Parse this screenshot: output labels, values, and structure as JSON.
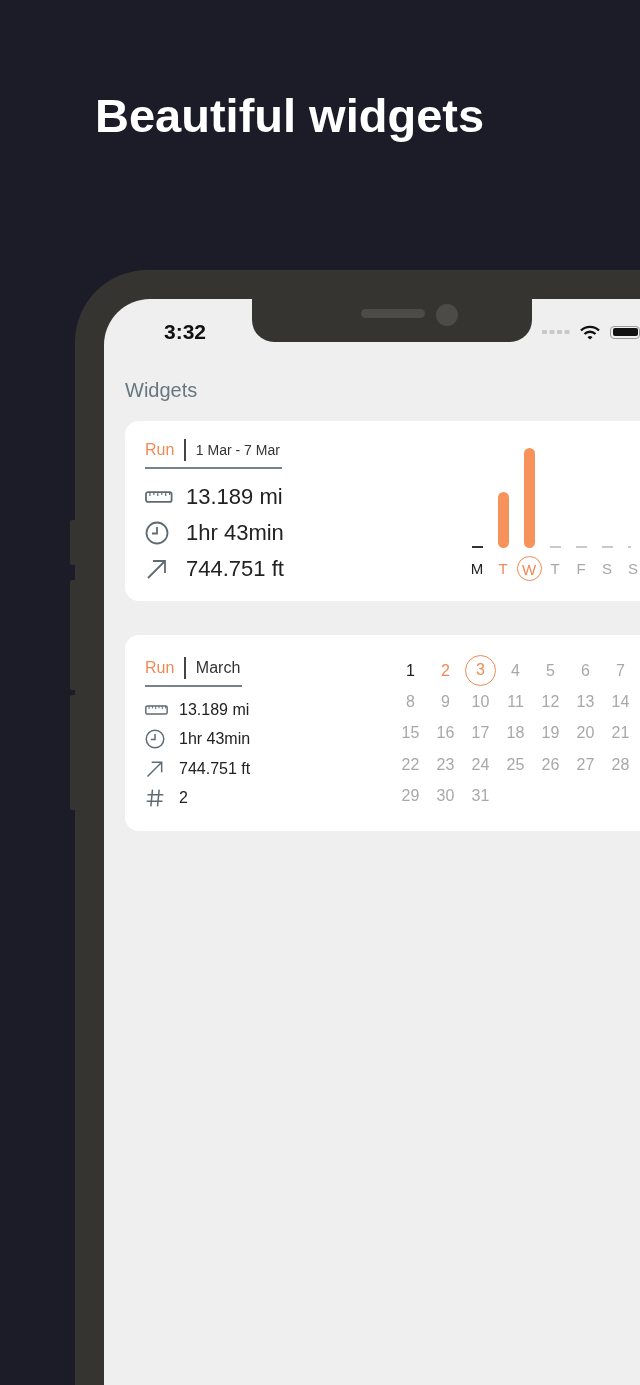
{
  "headline": "Beautiful widgets",
  "status_bar": {
    "time": "3:32"
  },
  "screen_title": "Widgets",
  "weekly_widget": {
    "activity": "Run",
    "period": "1 Mar - 7 Mar",
    "stats": [
      {
        "kind": "distance",
        "value": "13.189 mi"
      },
      {
        "kind": "duration",
        "value": "1hr 43min"
      },
      {
        "kind": "elevation",
        "value": "744.751 ft"
      }
    ],
    "days": [
      {
        "label": "M",
        "kind": "past"
      },
      {
        "label": "T",
        "kind": "active"
      },
      {
        "label": "W",
        "kind": "today"
      },
      {
        "label": "T",
        "kind": "future"
      },
      {
        "label": "F",
        "kind": "future"
      },
      {
        "label": "S",
        "kind": "future"
      },
      {
        "label": "S",
        "kind": "future"
      }
    ]
  },
  "monthly_widget": {
    "activity": "Run",
    "period": "March",
    "stats": [
      {
        "kind": "distance",
        "value": "13.189 mi"
      },
      {
        "kind": "duration",
        "value": "1hr 43min"
      },
      {
        "kind": "elevation",
        "value": "744.751 ft"
      },
      {
        "kind": "count",
        "value": "2"
      }
    ],
    "days": [
      {
        "label": "1",
        "kind": "past"
      },
      {
        "label": "2",
        "kind": "active"
      },
      {
        "label": "3",
        "kind": "today"
      },
      {
        "label": "4",
        "kind": "future"
      },
      {
        "label": "5",
        "kind": "future"
      },
      {
        "label": "6",
        "kind": "future"
      },
      {
        "label": "7",
        "kind": "future"
      },
      {
        "label": "8",
        "kind": "future"
      },
      {
        "label": "9",
        "kind": "future"
      },
      {
        "label": "10",
        "kind": "future"
      },
      {
        "label": "11",
        "kind": "future"
      },
      {
        "label": "12",
        "kind": "future"
      },
      {
        "label": "13",
        "kind": "future"
      },
      {
        "label": "14",
        "kind": "future"
      },
      {
        "label": "15",
        "kind": "future"
      },
      {
        "label": "16",
        "kind": "future"
      },
      {
        "label": "17",
        "kind": "future"
      },
      {
        "label": "18",
        "kind": "future"
      },
      {
        "label": "19",
        "kind": "future"
      },
      {
        "label": "20",
        "kind": "future"
      },
      {
        "label": "21",
        "kind": "future"
      },
      {
        "label": "22",
        "kind": "future"
      },
      {
        "label": "23",
        "kind": "future"
      },
      {
        "label": "24",
        "kind": "future"
      },
      {
        "label": "25",
        "kind": "future"
      },
      {
        "label": "26",
        "kind": "future"
      },
      {
        "label": "27",
        "kind": "future"
      },
      {
        "label": "28",
        "kind": "future"
      },
      {
        "label": "29",
        "kind": "future"
      },
      {
        "label": "30",
        "kind": "future"
      },
      {
        "label": "31",
        "kind": "future"
      }
    ]
  }
}
